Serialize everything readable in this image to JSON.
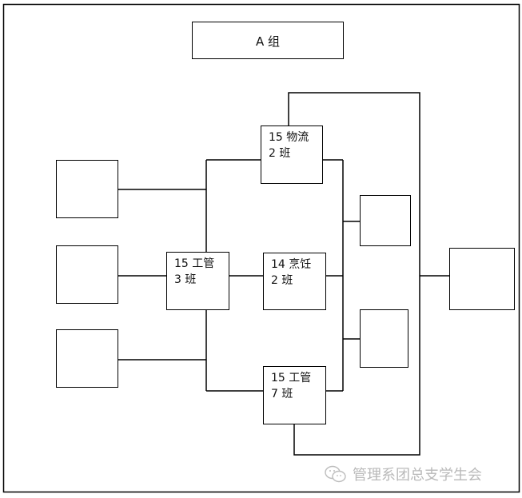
{
  "diagram": {
    "title": "A 组",
    "nodes": {
      "logistics": {
        "label": "15 物流\n2 班"
      },
      "mgmt3": {
        "label": "15 工管\n3 班"
      },
      "cooking": {
        "label": "14 烹饪\n2 班"
      },
      "mgmt7": {
        "label": "15 工管\n7 班"
      },
      "left_1": {
        "label": ""
      },
      "left_2": {
        "label": ""
      },
      "left_3": {
        "label": ""
      },
      "right_small_1": {
        "label": ""
      },
      "right_small_2": {
        "label": ""
      },
      "final": {
        "label": ""
      }
    }
  },
  "watermark": {
    "icon": "wechat-icon",
    "text": "管理系团总支学生会"
  }
}
